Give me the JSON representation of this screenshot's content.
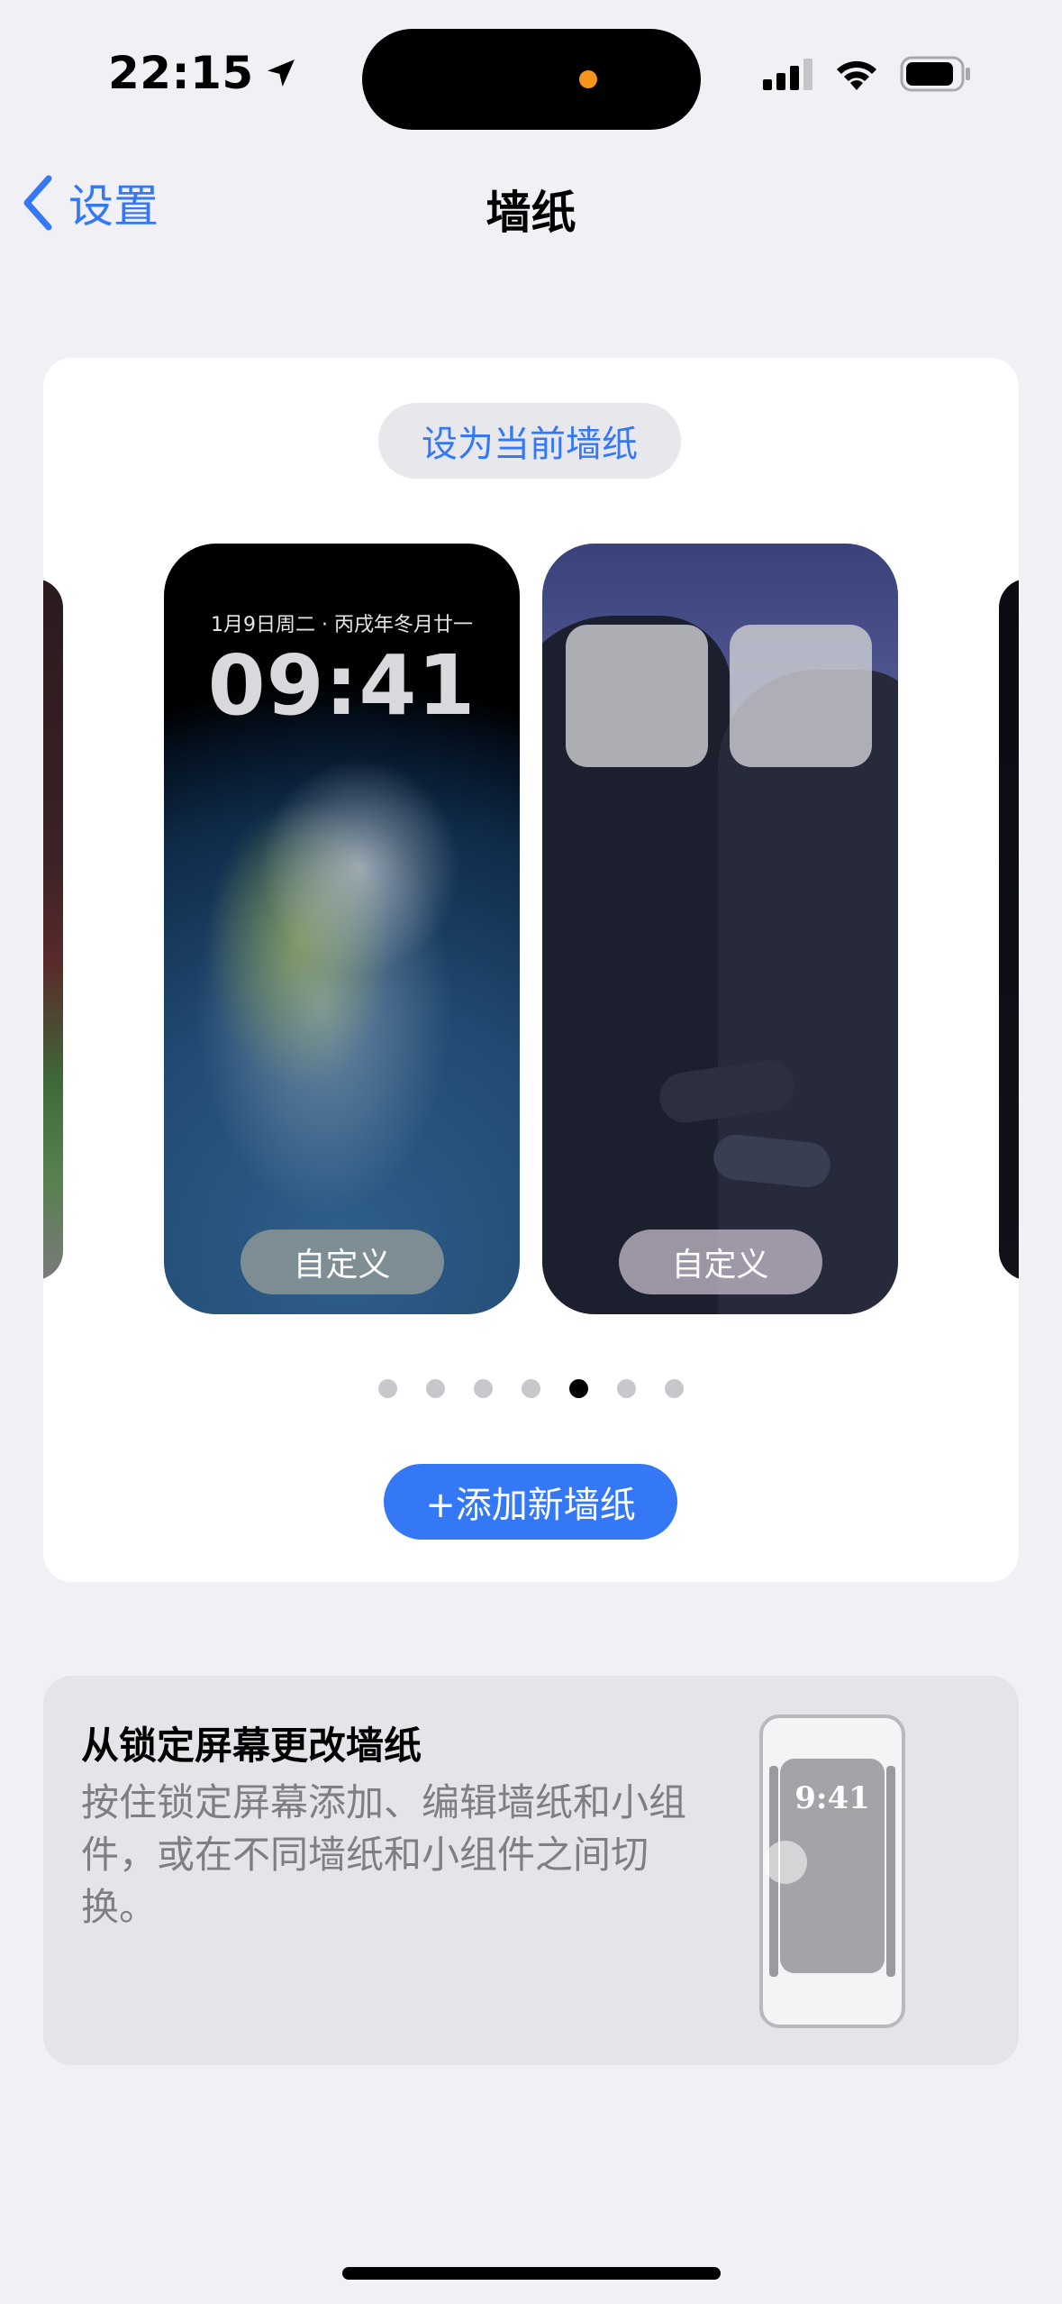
{
  "status_bar": {
    "time": "22:15",
    "icons": [
      "location-arrow-icon",
      "cellular-signal-icon",
      "wifi-icon",
      "battery-icon"
    ]
  },
  "nav": {
    "back_label": "设置",
    "title": "墙纸"
  },
  "wallpaper_card": {
    "set_current_label": "设为当前墙纸",
    "wallpapers": [
      {
        "name": "earth",
        "lock_date": "1月9日周二 · 丙戌年冬月廿一",
        "lock_time": "09:41",
        "customize_label": "自定义"
      },
      {
        "name": "anime-couple",
        "customize_label": "自定义"
      }
    ],
    "page_count": 7,
    "active_page": 5,
    "add_label": "+添加新墙纸"
  },
  "info_card": {
    "title": "从锁定屏幕更改墙纸",
    "body": "按住锁定屏幕添加、编辑墙纸和小组件，或在不同墙纸和小组件之间切换。",
    "illustration_time": "9:41"
  },
  "colors": {
    "accent": "#3478f6",
    "background": "#f0f0f5",
    "card": "#ffffff",
    "info_card": "#e4e4e9",
    "secondary_text": "#7e7e83"
  }
}
